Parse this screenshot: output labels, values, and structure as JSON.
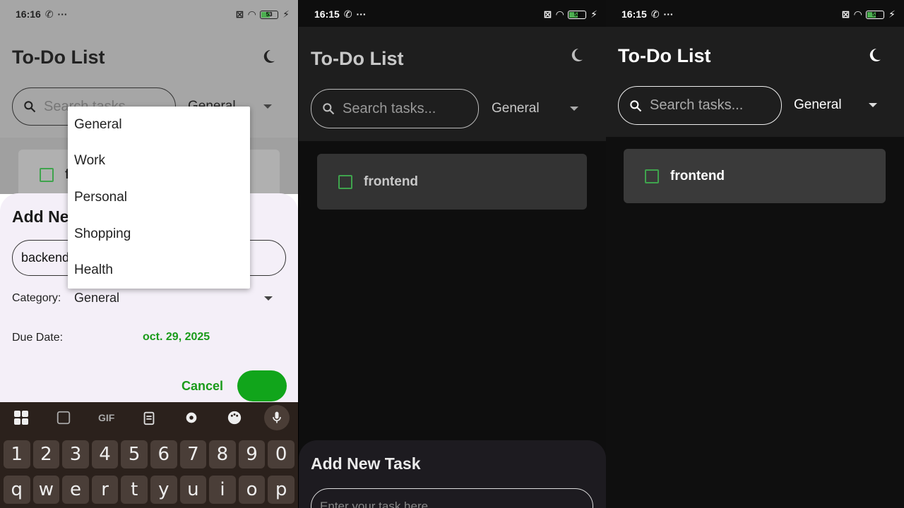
{
  "colors": {
    "accent_green": "#1a9b1a",
    "checkbox_green": "#3fa34d",
    "button_green": "#11a51b",
    "dark_bg": "#0f0f0f",
    "appbar_dark": "#1e1e1e"
  },
  "status_bar": [
    {
      "time": "16:16",
      "battery": "53"
    },
    {
      "time": "16:15",
      "battery": "53"
    },
    {
      "time": "16:15",
      "battery": "53"
    }
  ],
  "app": {
    "title": "To-Do List",
    "search_placeholder": "Search tasks...",
    "category_selected": "General",
    "theme_icon": "moon-icon"
  },
  "tasks": [
    {
      "name": "frontend",
      "done": false
    }
  ],
  "panel1": {
    "task_card_partial": "f",
    "dialog": {
      "title": "Add New Task",
      "task_input_value": "backend",
      "category_label": "Category:",
      "category_value": "General",
      "due_date_label": "Due Date:",
      "due_date_value": "oct. 29, 2025",
      "cancel_label": "Cancel"
    },
    "category_menu": [
      "General",
      "Work",
      "Personal",
      "Shopping",
      "Health"
    ],
    "keyboard": {
      "tools": [
        "apps-grid-icon",
        "sticker-icon",
        "GIF",
        "clipboard-icon",
        "gear-icon",
        "palette-icon",
        "mic-icon"
      ],
      "number_row": [
        "1",
        "2",
        "3",
        "4",
        "5",
        "6",
        "7",
        "8",
        "9",
        "0"
      ],
      "letter_row": [
        "q",
        "w",
        "e",
        "r",
        "t",
        "y",
        "u",
        "i",
        "o",
        "p"
      ]
    }
  },
  "panel2": {
    "sheet_title": "Add New Task",
    "task_input_placeholder": "Enter your task here"
  }
}
